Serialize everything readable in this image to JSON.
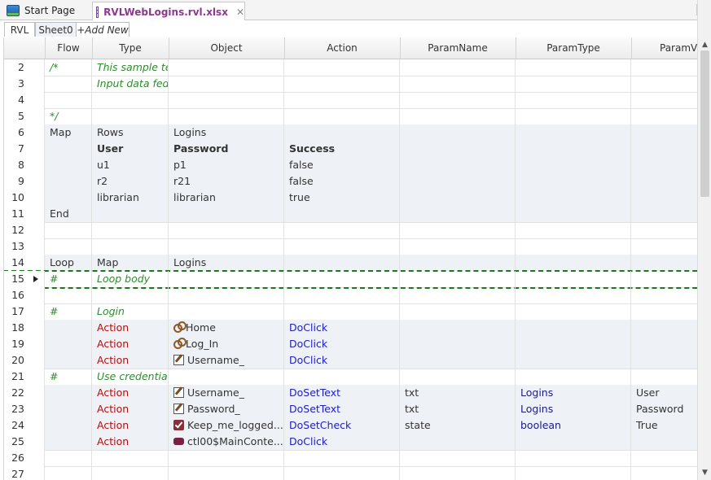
{
  "doc_tabs": {
    "start_page": "Start Page",
    "active_file": "RVLWebLogins.rvl.xlsx",
    "close": "✕",
    "dropdown": "▼"
  },
  "sheet_tabs": [
    "RVL",
    "Sheet0",
    "+Add New"
  ],
  "columns": [
    "Flow",
    "Type",
    "Object",
    "Action",
    "ParamName",
    "ParamType",
    "ParamV"
  ],
  "rows": [
    {
      "n": "2",
      "flow": "/*",
      "type": "This sample tests Login screen for Libraryinforationsystem demo website.",
      "object": "",
      "action": "",
      "pname": "",
      "ptype": "",
      "pval": "",
      "style": "comment"
    },
    {
      "n": "3",
      "flow": "",
      "type": "Input data fed from the 'Logins' map.",
      "object": "",
      "action": "",
      "pname": "",
      "ptype": "",
      "pval": "",
      "style": "comment"
    },
    {
      "n": "4",
      "flow": "",
      "type": "",
      "object": "",
      "action": "",
      "pname": "",
      "ptype": "",
      "pval": "",
      "style": "plain"
    },
    {
      "n": "5",
      "flow": "*/",
      "type": "",
      "object": "",
      "action": "",
      "pname": "",
      "ptype": "",
      "pval": "",
      "style": "comment"
    },
    {
      "n": "6",
      "flow": "Map",
      "type": "Rows",
      "object": "Logins",
      "action": "",
      "pname": "",
      "ptype": "",
      "pval": "",
      "style": "plain"
    },
    {
      "n": "7",
      "flow": "",
      "type": "User",
      "object": "Password",
      "action": "Success",
      "pname": "",
      "ptype": "",
      "pval": "",
      "style": "bold"
    },
    {
      "n": "8",
      "flow": "",
      "type": "u1",
      "object": "p1",
      "action": "false",
      "pname": "",
      "ptype": "",
      "pval": "",
      "style": "plain"
    },
    {
      "n": "9",
      "flow": "",
      "type": "r2",
      "object": "r21",
      "action": "false",
      "pname": "",
      "ptype": "",
      "pval": "",
      "style": "plain"
    },
    {
      "n": "10",
      "flow": "",
      "type": "librarian",
      "object": "librarian",
      "action": "true",
      "pname": "",
      "ptype": "",
      "pval": "",
      "style": "plain"
    },
    {
      "n": "11",
      "flow": "End",
      "type": "",
      "object": "",
      "action": "",
      "pname": "",
      "ptype": "",
      "pval": "",
      "style": "plain"
    },
    {
      "n": "12",
      "flow": "",
      "type": "",
      "object": "",
      "action": "",
      "pname": "",
      "ptype": "",
      "pval": "",
      "style": "plain"
    },
    {
      "n": "13",
      "flow": "",
      "type": "",
      "object": "",
      "action": "",
      "pname": "",
      "ptype": "",
      "pval": "",
      "style": "plain"
    },
    {
      "n": "14",
      "flow": "Loop",
      "type": "Map",
      "object": "Logins",
      "action": "",
      "pname": "",
      "ptype": "",
      "pval": "",
      "style": "plain"
    },
    {
      "n": "15",
      "flow": "#",
      "type": "Loop body",
      "object": "",
      "action": "",
      "pname": "",
      "ptype": "",
      "pval": "",
      "style": "comment-selected"
    },
    {
      "n": "16",
      "flow": "",
      "type": "",
      "object": "",
      "action": "",
      "pname": "",
      "ptype": "",
      "pval": "",
      "style": "plain"
    },
    {
      "n": "17",
      "flow": "#",
      "type": "Login",
      "object": "",
      "action": "",
      "pname": "",
      "ptype": "",
      "pval": "",
      "style": "comment"
    },
    {
      "n": "18",
      "flow": "",
      "type": "Action",
      "object": "Home",
      "icon": "link-icon",
      "action": "DoClick",
      "pname": "",
      "ptype": "",
      "pval": "",
      "style": "action"
    },
    {
      "n": "19",
      "flow": "",
      "type": "Action",
      "object": "Log_In",
      "icon": "link-icon",
      "action": "DoClick",
      "pname": "",
      "ptype": "",
      "pval": "",
      "style": "action"
    },
    {
      "n": "20",
      "flow": "",
      "type": "Action",
      "object": "Username_",
      "icon": "edit-icon",
      "action": "DoClick",
      "pname": "",
      "ptype": "",
      "pval": "",
      "style": "action"
    },
    {
      "n": "21",
      "flow": "#",
      "type": "Use credentials from Logins Map",
      "object": "",
      "action": "",
      "pname": "",
      "ptype": "",
      "pval": "",
      "style": "comment"
    },
    {
      "n": "22",
      "flow": "",
      "type": "Action",
      "object": "Username_",
      "icon": "edit-icon",
      "action": "DoSetText",
      "pname": "txt",
      "ptype": "Logins",
      "pval": "User",
      "style": "action"
    },
    {
      "n": "23",
      "flow": "",
      "type": "Action",
      "object": "Password_",
      "icon": "edit-icon",
      "action": "DoSetText",
      "pname": "txt",
      "ptype": "Logins",
      "pval": "Password",
      "style": "action"
    },
    {
      "n": "24",
      "flow": "",
      "type": "Action",
      "object": "Keep_me_logged...",
      "icon": "checkbox-icon",
      "action": "DoSetCheck",
      "pname": "state",
      "ptype": "boolean",
      "pval": "True",
      "style": "action"
    },
    {
      "n": "25",
      "flow": "",
      "type": "Action",
      "object": "ctl00$MainConte...",
      "icon": "button-icon",
      "action": "DoClick",
      "pname": "",
      "ptype": "",
      "pval": "",
      "style": "action"
    },
    {
      "n": "26",
      "flow": "",
      "type": "",
      "object": "",
      "action": "",
      "pname": "",
      "ptype": "",
      "pval": "",
      "style": "plain"
    },
    {
      "n": "27",
      "flow": "",
      "type": "",
      "object": "",
      "action": "",
      "pname": "",
      "ptype": "",
      "pval": "",
      "style": "plain"
    }
  ],
  "scrollbar": {
    "up": "▲",
    "down": "▼"
  }
}
